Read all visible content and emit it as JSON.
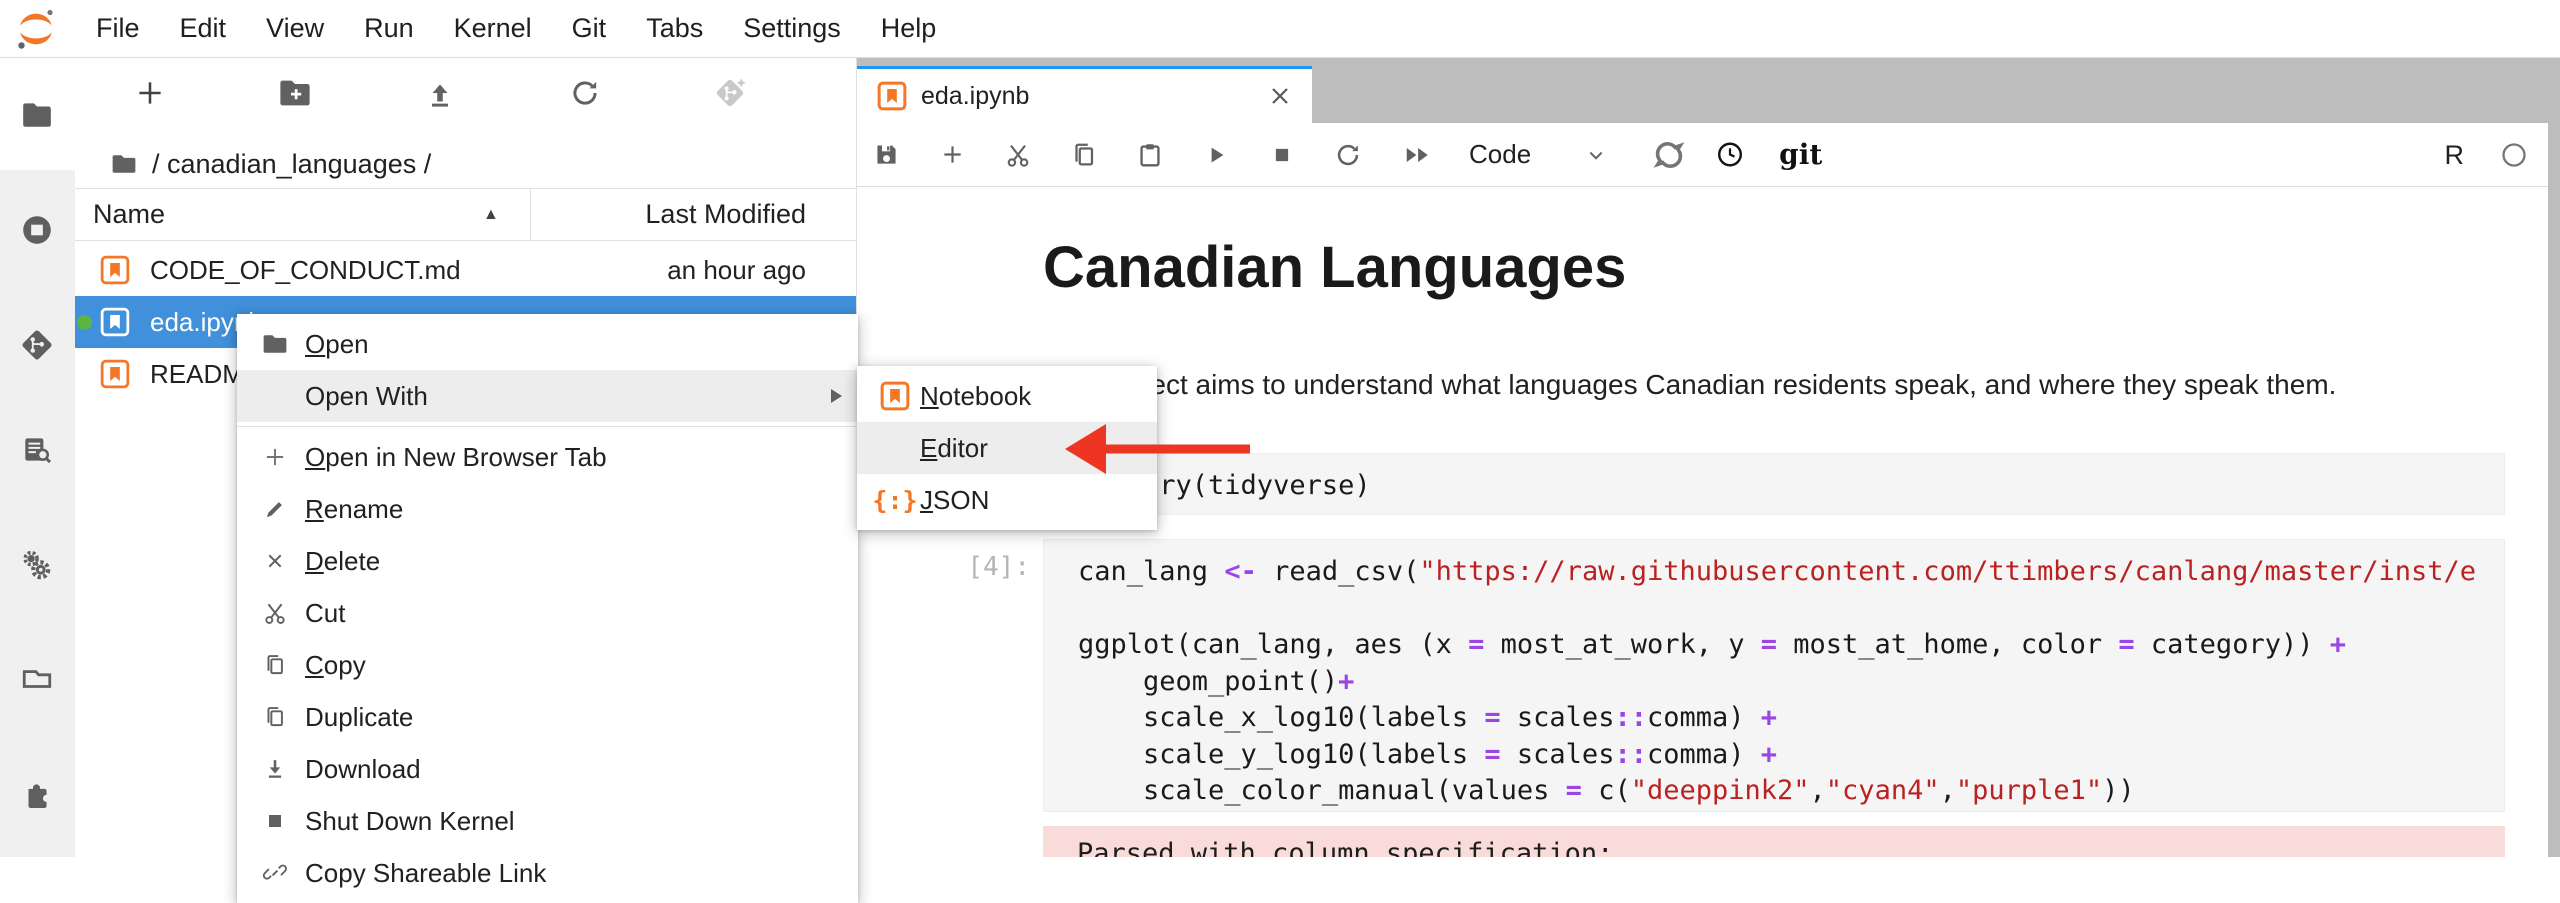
{
  "menubar": {
    "logo": "jupyter-logo",
    "items": [
      "File",
      "Edit",
      "View",
      "Run",
      "Kernel",
      "Git",
      "Tabs",
      "Settings",
      "Help"
    ]
  },
  "sidebar": {
    "icons": [
      "file-browser",
      "running-kernels",
      "git",
      "command-palette",
      "property-inspector",
      "open-tabs",
      "extension-manager"
    ]
  },
  "filebrowser": {
    "toolbar_icons": [
      "new-launcher",
      "new-folder",
      "upload",
      "refresh",
      "git-clone"
    ],
    "breadcrumb": {
      "path": "/ canadian_languages /"
    },
    "header": {
      "name": "Name",
      "last_modified": "Last Modified",
      "sort": "asc"
    },
    "files": [
      {
        "name": "CODE_OF_CONDUCT.md",
        "type": "markdown",
        "modified": "an hour ago"
      },
      {
        "name": "eda.ipynb",
        "type": "notebook",
        "modified": "",
        "selected": true,
        "kernel_running": true
      },
      {
        "name": "README.md",
        "type": "markdown",
        "modified": ""
      }
    ]
  },
  "context_menu": {
    "items": [
      {
        "label": "Open",
        "icon": "folder"
      },
      {
        "label": "Open With",
        "has_submenu": true
      },
      {
        "label": "Open in New Browser Tab",
        "icon": "plus"
      },
      {
        "label": "Rename",
        "icon": "pencil"
      },
      {
        "label": "Delete",
        "icon": "close"
      },
      {
        "label": "Cut",
        "icon": "scissors"
      },
      {
        "label": "Copy",
        "icon": "copy"
      },
      {
        "label": "Duplicate",
        "icon": "copy"
      },
      {
        "label": "Download",
        "icon": "download"
      },
      {
        "label": "Shut Down Kernel",
        "icon": "stop"
      },
      {
        "label": "Copy Shareable Link",
        "icon": "link"
      }
    ],
    "submenu": {
      "json_glyph": "{:}",
      "items": [
        {
          "label": "Notebook",
          "icon": "notebook"
        },
        {
          "label": "Editor",
          "highlighted": true
        },
        {
          "label": "JSON",
          "icon": "json"
        }
      ]
    }
  },
  "notebook": {
    "tab": {
      "title": "eda.ipynb",
      "icon": "notebook"
    },
    "toolbar": {
      "icons": [
        "save",
        "add-cell",
        "cut-cells",
        "copy-cells",
        "paste-cells",
        "run",
        "stop",
        "restart-kernel",
        "restart-run-all",
        "cell-type-dropdown",
        "nbdime-diff",
        "history",
        "git"
      ],
      "cell_type": "Code",
      "git_label": "git",
      "kernel_name": "R",
      "kernel_status": "idle"
    },
    "heading": "Canadian Languages",
    "paragraph": "This project aims to understand what languages Canadian residents speak, and where they speak them.",
    "cells": [
      {
        "prompt": "",
        "lines": [
          [
            [
              "t",
              "library(tidyverse)"
            ]
          ]
        ]
      },
      {
        "prompt": "[4]:",
        "lines": [
          [
            [
              "t",
              "can_lang "
            ],
            [
              "op",
              "<-"
            ],
            [
              "t",
              " read_csv("
            ],
            [
              "str",
              "\"https://raw.githubusercontent.com/ttimbers/canlang/master/inst/e"
            ]
          ],
          [
            [
              "t",
              ""
            ]
          ],
          [
            [
              "t",
              "ggplot(can_lang, aes (x "
            ],
            [
              "op",
              "="
            ],
            [
              "t",
              " most_at_work, y "
            ],
            [
              "op",
              "="
            ],
            [
              "t",
              " most_at_home, color "
            ],
            [
              "op",
              "="
            ],
            [
              "t",
              " category)) "
            ],
            [
              "op",
              "+"
            ]
          ],
          [
            [
              "t",
              "    geom_point()"
            ],
            [
              "op",
              "+"
            ]
          ],
          [
            [
              "t",
              "    scale_x_log10(labels "
            ],
            [
              "op",
              "="
            ],
            [
              "t",
              " scales"
            ],
            [
              "op",
              "::"
            ],
            [
              "t",
              "comma) "
            ],
            [
              "op",
              "+"
            ]
          ],
          [
            [
              "t",
              "    scale_y_log10(labels "
            ],
            [
              "op",
              "="
            ],
            [
              "t",
              " scales"
            ],
            [
              "op",
              "::"
            ],
            [
              "t",
              "comma) "
            ],
            [
              "op",
              "+"
            ]
          ],
          [
            [
              "t",
              "    scale_color_manual(values "
            ],
            [
              "op",
              "="
            ],
            [
              "t",
              " c("
            ],
            [
              "str",
              "\"deeppink2\""
            ],
            [
              "t",
              ","
            ],
            [
              "str",
              "\"cyan4\""
            ],
            [
              "t",
              ","
            ],
            [
              "str",
              "\"purple1\""
            ],
            [
              "t",
              "))"
            ]
          ]
        ]
      }
    ],
    "output": {
      "text": "Parsed with column specification:"
    }
  },
  "annotation": {
    "arrow_color": "#ee3524",
    "points_to": "Editor"
  }
}
